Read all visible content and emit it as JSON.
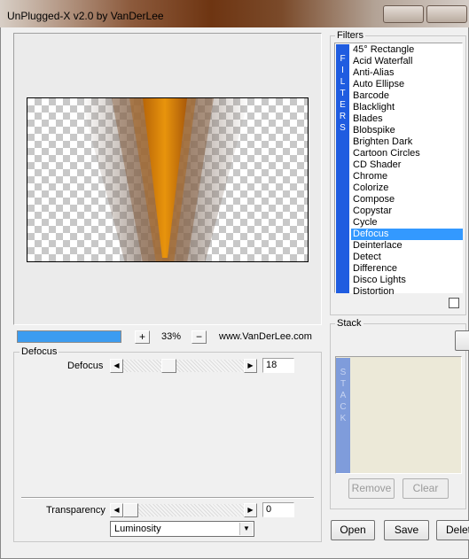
{
  "window": {
    "title": "UnPlugged-X v2.0 by VanDerLee"
  },
  "preview": {
    "zoom_in": "+",
    "zoom_out": "−",
    "zoom": "33%",
    "website": "www.VanDerLee.com",
    "progress": 1.0
  },
  "defocus_group": {
    "label": "Defocus",
    "slider_label": "Defocus",
    "value": "18",
    "level": 0.18
  },
  "bottom": {
    "transparency_label": "Transparency",
    "transparency_value": "0",
    "transparency_level": 0.0,
    "blend_mode": "Luminosity"
  },
  "filters": {
    "label": "Filters",
    "strip_letters": [
      "F",
      "I",
      "L",
      "T",
      "E",
      "R",
      "S"
    ],
    "items": [
      "45° Rectangle",
      "Acid Waterfall",
      "Anti-Alias",
      "Auto Ellipse",
      "Barcode",
      "Blacklight",
      "Blades",
      "Blobspike",
      "Brighten Dark",
      "Cartoon Circles",
      "CD Shader",
      "Chrome",
      "Colorize",
      "Compose",
      "Copystar",
      "Cycle",
      "Defocus",
      "Deinterlace",
      "Detect",
      "Difference",
      "Disco Lights",
      "Distortion"
    ],
    "selected": "Defocus"
  },
  "stack": {
    "label": "Stack",
    "strip_letters": [
      "S",
      "T",
      "A",
      "C",
      "K"
    ],
    "remove": "Remove",
    "clear": "Clear"
  },
  "buttons": {
    "open": "Open",
    "save": "Save",
    "delete": "Delete"
  },
  "colors": {
    "accent": "#3399ff",
    "filters_strip": "#1f5ce0",
    "stack_strip": "#7f9cdb"
  }
}
